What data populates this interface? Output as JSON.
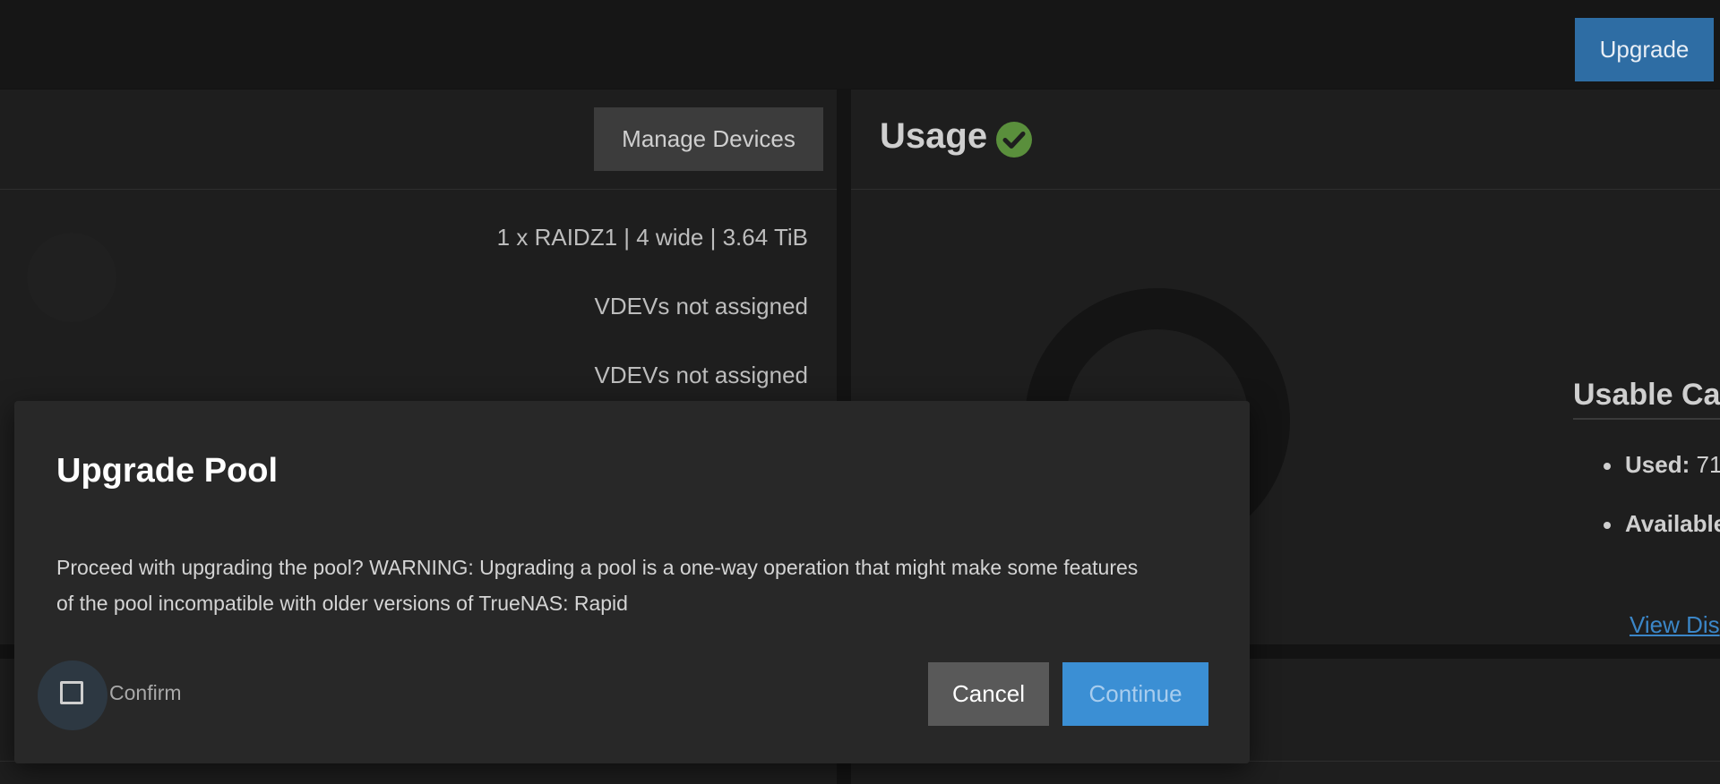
{
  "header": {
    "upgrade_label": "Upgrade"
  },
  "topology": {
    "manage_devices_label": "Manage Devices",
    "rows": [
      "1 x RAIDZ1 | 4 wide | 3.64 TiB",
      "VDEVs not assigned",
      "VDEVs not assigned"
    ]
  },
  "usage": {
    "title": "Usage",
    "status_icon": "check-circle-icon",
    "status_color": "#5a8f3c",
    "usable_title": "Usable Ca",
    "used_label": "Used:",
    "used_value": "71",
    "available_label": "Available",
    "view_link": "View Dis"
  },
  "dialog": {
    "title": "Upgrade Pool",
    "message_line1": "Proceed with upgrading the pool? WARNING: Upgrading a pool is a one-way operation that might make some features",
    "message_line2": "of the pool incompatible with older versions of TrueNAS: Rapid",
    "confirm_label": "Confirm",
    "confirm_checked": false,
    "cancel_label": "Cancel",
    "continue_label": "Continue"
  },
  "colors": {
    "accent": "#3b8fd4",
    "header_button": "#2e6da4",
    "background": "#131313",
    "card": "#1e1e1e",
    "dialog": "#282828"
  }
}
